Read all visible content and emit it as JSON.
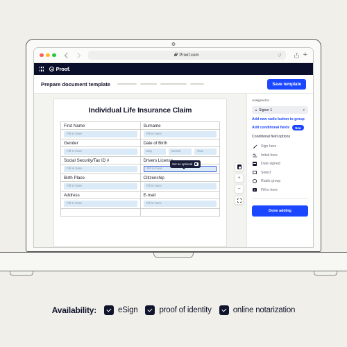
{
  "browser": {
    "url": "Proof.com",
    "lock_icon": "lock-icon",
    "reload_icon": "reload-icon",
    "share_icon": "share-icon",
    "new_tab_icon": "plus-icon"
  },
  "app_nav": {
    "grid_icon": "app-grid-icon",
    "brand": "Proof."
  },
  "header": {
    "title": "Prepare document template",
    "save_label": "Save template",
    "steps": [
      28,
      24,
      38,
      20
    ]
  },
  "document": {
    "title": "Individual Life Insurance Claim",
    "placeholder": "Fill in here",
    "rows": [
      {
        "left_label": "First Name",
        "right_label": "Surname"
      },
      {
        "left_label": "Gender",
        "right_label": "Date of Birth"
      },
      {
        "left_label": "Social Security/Tax ID #",
        "right_label": "Drivers License"
      },
      {
        "left_label": "Birth Place",
        "right_label": "Citizenship"
      },
      {
        "left_label": "Address",
        "right_label": "E-mail"
      }
    ],
    "dob_fields": [
      "Day",
      "Month",
      "Year"
    ],
    "tooltip": {
      "label": "Set as optional",
      "delete_icon": "trash-icon"
    }
  },
  "float_tools": [
    {
      "name": "page-icon"
    },
    {
      "name": "zoom-in-icon",
      "glyph": "+"
    },
    {
      "name": "zoom-out-icon",
      "glyph": "−"
    },
    {
      "name": "fullscreen-icon"
    }
  ],
  "sidebar": {
    "assigned_label": "Assigned to",
    "assigned_value": "Signer 1",
    "link_radio": "Add new radio button to group",
    "link_conditional": "Add conditional fields",
    "badge_new": "New",
    "section_title": "Conditional field options",
    "options": [
      {
        "label": "Sign here",
        "icon": "pen-icon"
      },
      {
        "label": "Initial here",
        "icon": "signature-icon"
      },
      {
        "label": "Date signed",
        "icon": "calendar-icon"
      },
      {
        "label": "Select",
        "icon": "checkbox-icon"
      },
      {
        "label": "Radio group",
        "icon": "radio-icon"
      },
      {
        "label": "Fill in here",
        "icon": "text-field-icon"
      }
    ],
    "done_label": "Done adding"
  },
  "availability": {
    "label": "Availability:",
    "items": [
      "eSign",
      "proof of identity",
      "online notarization"
    ]
  },
  "colors": {
    "page_bg": "#f0efe9",
    "brand_navy": "#0a0f2b",
    "accent_blue": "#1a47ff",
    "field_blue": "#dbeaf7"
  }
}
